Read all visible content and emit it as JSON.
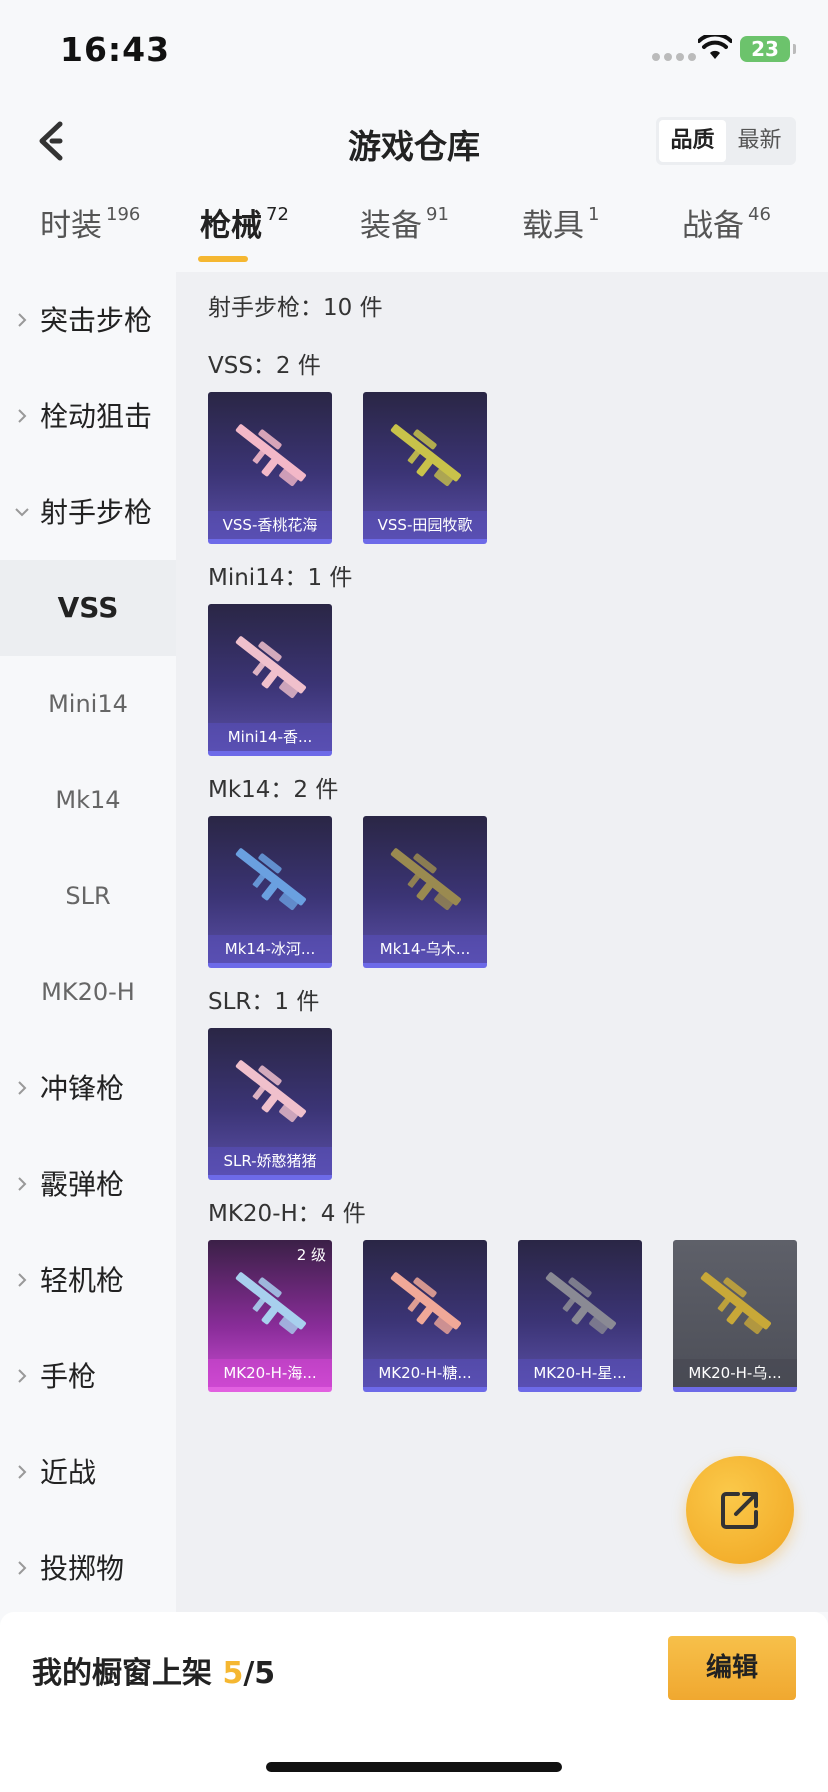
{
  "status_bar": {
    "time": "16:43",
    "battery": "23"
  },
  "header": {
    "title": "游戏仓库",
    "sort_options": [
      "品质",
      "最新"
    ],
    "active_sort": "品质"
  },
  "tabs": [
    {
      "label": "时装",
      "count": "196"
    },
    {
      "label": "枪械",
      "count": "72"
    },
    {
      "label": "装备",
      "count": "91"
    },
    {
      "label": "载具",
      "count": "1"
    },
    {
      "label": "战备",
      "count": "46"
    }
  ],
  "active_tab": "枪械",
  "sidebar": {
    "categories": [
      "突击步枪",
      "栓动狙击",
      "射手步枪",
      "冲锋枪",
      "霰弹枪",
      "轻机枪",
      "手枪",
      "近战",
      "投掷物"
    ],
    "expanded": "射手步枪",
    "subcategories": [
      "VSS",
      "Mini14",
      "Mk14",
      "SLR",
      "MK20-H"
    ],
    "active_sub": "VSS"
  },
  "main": {
    "section_title": "射手步枪：10 件",
    "groups": [
      {
        "title": "VSS：2 件",
        "items": [
          {
            "name": "VSS-香桃花海",
            "color": "#f3b8c8",
            "style": "normal"
          },
          {
            "name": "VSS-田园牧歌",
            "color": "#c8c24a",
            "style": "normal"
          }
        ]
      },
      {
        "title": "Mini14：1 件",
        "items": [
          {
            "name": "Mini14-香...",
            "color": "#f0c0cc",
            "style": "normal"
          }
        ]
      },
      {
        "title": "Mk14：2 件",
        "items": [
          {
            "name": "Mk14-冰河...",
            "color": "#6aa0e0",
            "style": "normal"
          },
          {
            "name": "Mk14-乌木...",
            "color": "#9a8a50",
            "style": "normal"
          }
        ]
      },
      {
        "title": "SLR：1 件",
        "items": [
          {
            "name": "SLR-娇憨猪猪",
            "color": "#f0c0cc",
            "style": "normal"
          }
        ]
      },
      {
        "title": "MK20-H：4 件",
        "items": [
          {
            "name": "MK20-H-海...",
            "color": "#a8d0ee",
            "style": "pink",
            "badge": "2 级"
          },
          {
            "name": "MK20-H-糖...",
            "color": "#f0a898",
            "style": "normal"
          },
          {
            "name": "MK20-H-星...",
            "color": "#8a8a94",
            "style": "normal"
          },
          {
            "name": "MK20-H-乌...",
            "color": "#c8a838",
            "style": "gray"
          }
        ]
      }
    ]
  },
  "bottom_bar": {
    "shelf_label": "我的橱窗上架",
    "shelf_current": "5",
    "shelf_total": "/5",
    "edit_label": "编辑"
  },
  "colors": {
    "accent": "#f5b731",
    "card_border": "#6d6ae8",
    "pink_border": "#e260e0"
  }
}
